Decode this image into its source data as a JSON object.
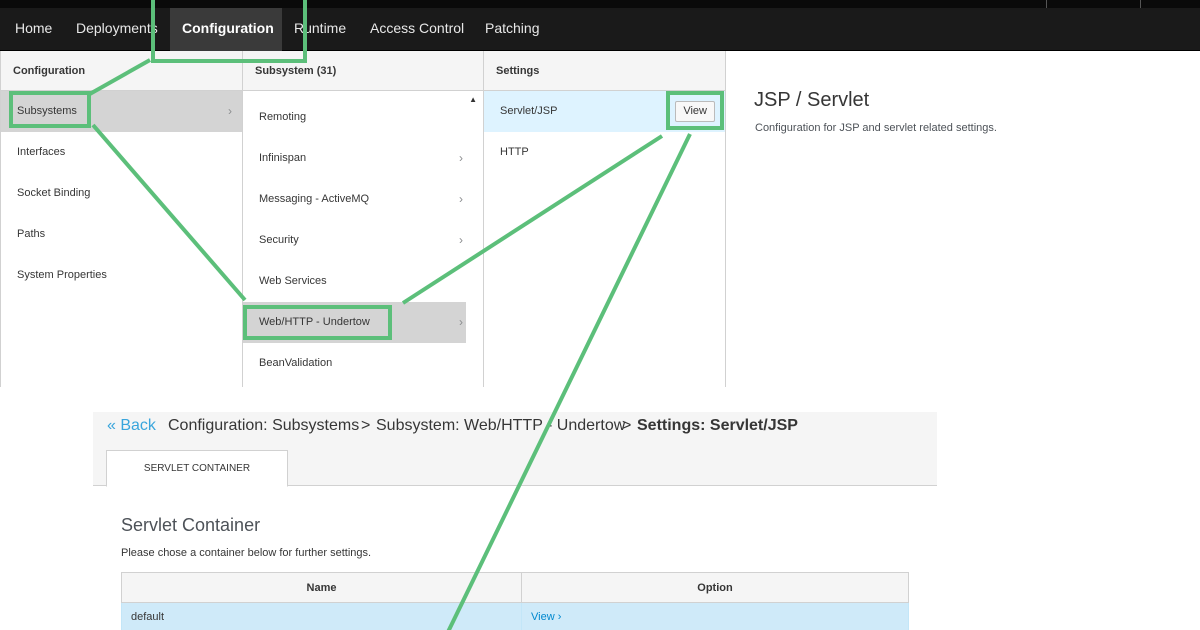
{
  "topnav": {
    "items": [
      {
        "label": "Home"
      },
      {
        "label": "Deployments"
      },
      {
        "label": "Configuration"
      },
      {
        "label": "Runtime"
      },
      {
        "label": "Access Control"
      },
      {
        "label": "Patching"
      }
    ],
    "active": "Configuration"
  },
  "columns": {
    "configuration": {
      "header": "Configuration",
      "items": [
        {
          "label": "Subsystems"
        },
        {
          "label": "Interfaces"
        },
        {
          "label": "Socket Binding"
        },
        {
          "label": "Paths"
        },
        {
          "label": "System Properties"
        }
      ]
    },
    "subsystem": {
      "header": "Subsystem (31)",
      "items": [
        {
          "label": "Remoting"
        },
        {
          "label": "Infinispan"
        },
        {
          "label": "Messaging - ActiveMQ"
        },
        {
          "label": "Security"
        },
        {
          "label": "Web Services"
        },
        {
          "label": "Web/HTTP - Undertow"
        },
        {
          "label": "BeanValidation"
        }
      ]
    },
    "settings": {
      "header": "Settings",
      "items": [
        {
          "label": "Servlet/JSP"
        },
        {
          "label": "HTTP"
        }
      ],
      "view_button": "View"
    }
  },
  "preview": {
    "title": "JSP / Servlet",
    "description": "Configuration for JSP and servlet related settings."
  },
  "detail": {
    "back": "« Back",
    "breadcrumb": [
      "Configuration: Subsystems",
      "Subsystem: Web/HTTP - Undertow",
      "Settings: Servlet/JSP"
    ],
    "crumb_separator": ">",
    "tab": "SERVLET CONTAINER",
    "section_title": "Servlet Container",
    "section_desc": "Please chose a container below for further settings.",
    "table": {
      "headers": [
        "Name",
        "Option"
      ],
      "rows": [
        {
          "name": "default",
          "option": "View ›"
        }
      ]
    }
  },
  "highlight_color": "#5cbf7a"
}
